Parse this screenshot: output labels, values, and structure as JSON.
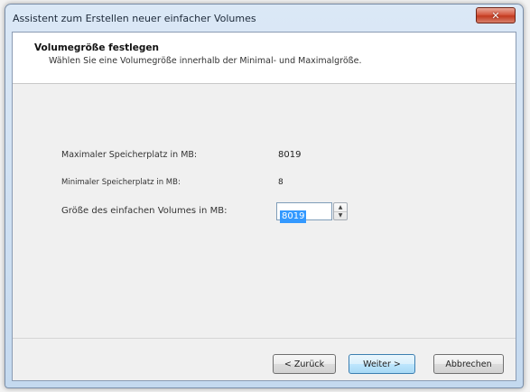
{
  "window": {
    "title": "Assistent zum Erstellen neuer einfacher Volumes",
    "close_glyph": "✕"
  },
  "header": {
    "title": "Volumegröße festlegen",
    "subtitle": "Wählen Sie eine Volumegröße innerhalb der Minimal- und Maximalgröße."
  },
  "fields": {
    "max_label": "Maximaler Speicherplatz in MB:",
    "max_value": "8019",
    "min_label": "Minimaler Speicherplatz in MB:",
    "min_value": "8",
    "size_label": "Größe des einfachen Volumes in MB:",
    "size_value": "8019"
  },
  "buttons": {
    "back": "< Zurück",
    "next": "Weiter >",
    "cancel": "Abbrechen"
  },
  "icons": {
    "spin_up": "▲",
    "spin_down": "▼"
  }
}
